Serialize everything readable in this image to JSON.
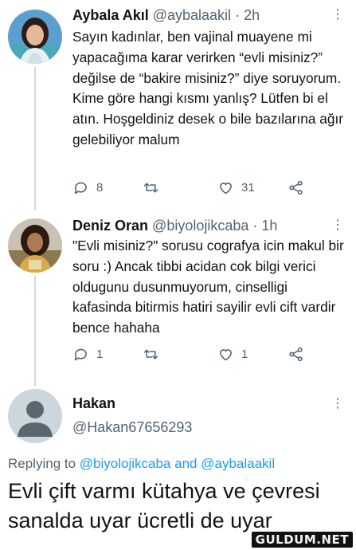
{
  "tweets": [
    {
      "name": "Aybala Akıl",
      "handle": "@aybalaakil",
      "separator": "·",
      "time": "2h",
      "text": "Sayın kadınlar, ben vajinal muayene mi yapacağıma karar verirken “evli misiniz?” değilse de “bakire misiniz?” diye soruyorum. Kime göre hangi kısmı yanlış? Lütfen bi el atın. Hoşgeldiniz desek o bile bazılarına ağır gelebiliyor malum",
      "replies": "8",
      "retweets": "",
      "likes": "31"
    },
    {
      "name": "Deniz Oran",
      "handle": "@biyolojikcaba",
      "separator": "·",
      "time": "1h",
      "text": "\"Evli misiniz?\" sorusu cografya icin makul bir soru :) Ancak tibbi acidan cok bilgi verici oldugunu dusunmuyorum, cinselligi kafasinda bitirmis hatiri sayilir evli cift vardir bence hahaha",
      "replies": "1",
      "retweets": "",
      "likes": "1"
    }
  ],
  "reply": {
    "name": "Hakan",
    "handle": "@Hakan67656293",
    "replying_prefix": "Replying to",
    "replying_to_1": "@biyolojikcaba",
    "replying_and": "and",
    "replying_to_2": "@aybalaakil",
    "text": "Evli çift varmı kütahya ve çevresi sanalda uyar ücretli  de uyar"
  },
  "watermark": "GULDUM.NET",
  "icons": {
    "reply": "reply-icon",
    "retweet": "retweet-icon",
    "like": "heart-icon",
    "share": "share-icon",
    "more": "more-icon"
  },
  "colors": {
    "text": "#0f1419",
    "secondary": "#536471",
    "link": "#1d9bf0",
    "thread_line": "#cfd9de"
  }
}
